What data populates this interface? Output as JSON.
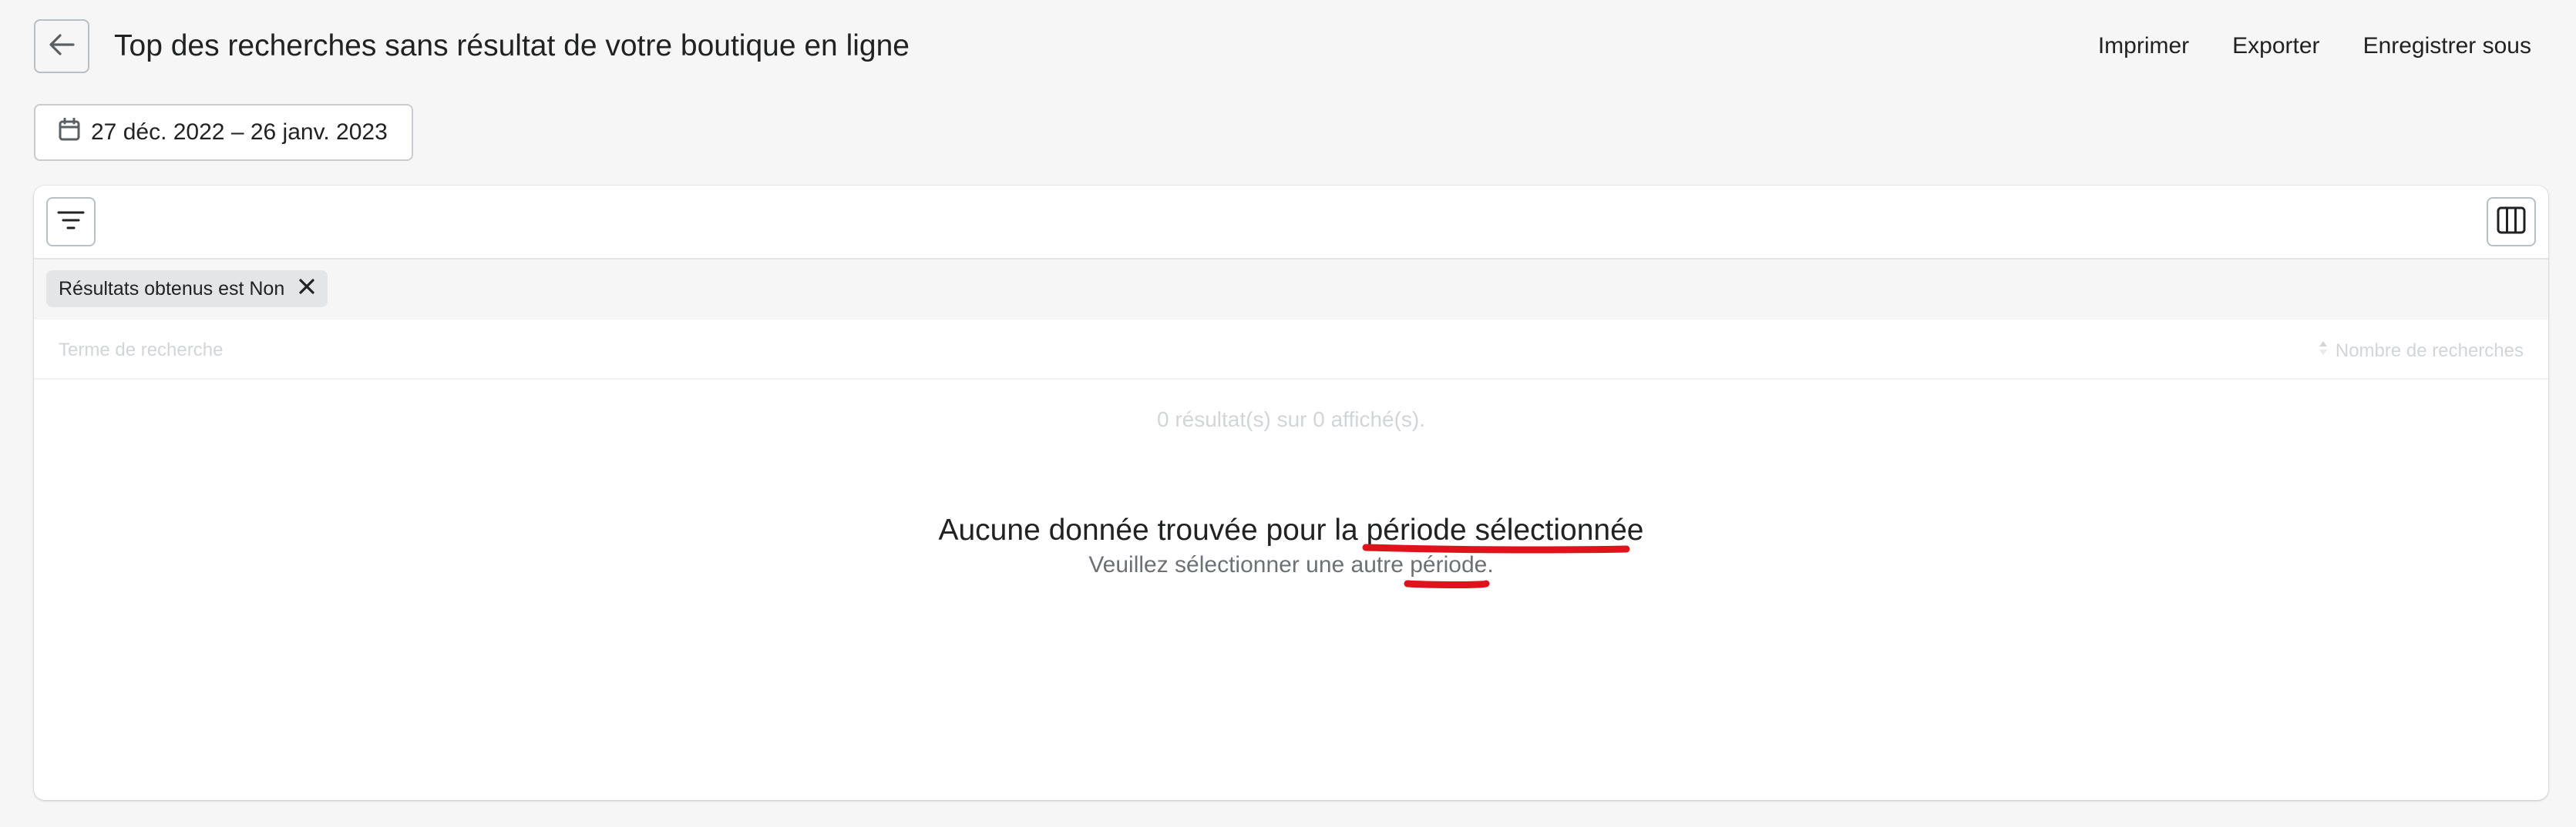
{
  "header": {
    "title": "Top des recherches sans résultat de votre boutique en ligne",
    "actions": {
      "print": "Imprimer",
      "export": "Exporter",
      "save_as": "Enregistrer sous"
    }
  },
  "date_range": {
    "label": "27 déc. 2022 – 26 janv. 2023"
  },
  "filters": {
    "active_tag": "Résultats obtenus est Non"
  },
  "table": {
    "columns": {
      "term": "Terme de recherche",
      "count": "Nombre de recherches"
    },
    "summary": "0 résultat(s) sur 0 affiché(s)."
  },
  "empty_state": {
    "title": "Aucune donnée trouvée pour la période sélectionnée",
    "subtitle": "Veuillez sélectionner une autre période."
  },
  "colors": {
    "background": "#f6f6f6",
    "card": "#ffffff",
    "text": "#202223",
    "muted": "#6d7175",
    "annotation": "#e0121b"
  },
  "icons": {
    "back": "arrow-left-icon",
    "calendar": "calendar-icon",
    "filter": "filter-icon",
    "columns": "columns-icon",
    "remove": "close-icon",
    "sort": "sort-icon"
  }
}
